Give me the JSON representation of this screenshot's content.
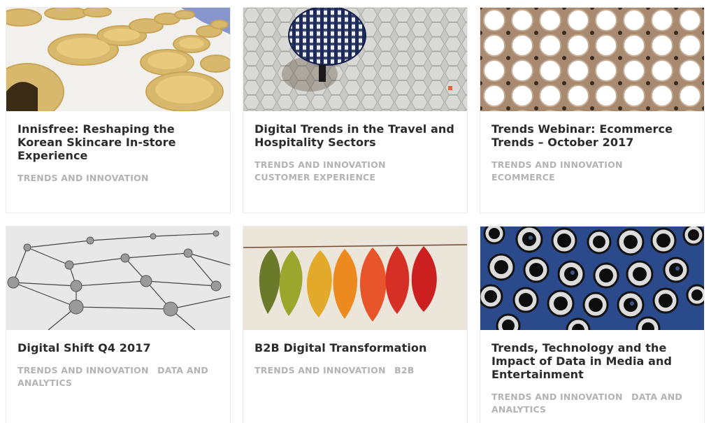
{
  "articles": [
    {
      "title": "Innisfree: Reshaping the Korean Skincare In-store Experience",
      "image": "concrete-planters-photo",
      "tags": [
        "TRENDS AND INNOVATION"
      ]
    },
    {
      "title": "Digital Trends in the Travel and Hospitality Sectors",
      "image": "umbrella-on-pavement-photo",
      "tags": [
        "TRENDS AND INNOVATION",
        "CUSTOMER EXPERIENCE"
      ]
    },
    {
      "title": "Trends Webinar: Ecommerce Trends – October 2017",
      "image": "circle-pattern-photo",
      "tags": [
        "TRENDS AND INNOVATION",
        "ECOMMERCE"
      ]
    },
    {
      "title": "Digital Shift Q4 2017",
      "image": "network-nodes-photo",
      "tags": [
        "TRENDS AND INNOVATION",
        "DATA AND ANALYTICS"
      ]
    },
    {
      "title": "B2B Digital Transformation",
      "image": "autumn-leaves-photo",
      "tags": [
        "TRENDS AND INNOVATION",
        "B2B"
      ]
    },
    {
      "title": "Trends, Technology and the Impact of Data in Media and Entertainment",
      "image": "camera-lenses-photo",
      "tags": [
        "TRENDS AND INNOVATION",
        "DATA AND ANALYTICS"
      ]
    }
  ],
  "colors": {
    "title": "#2b2b2b",
    "tag": "#b3b3b3",
    "border": "#ececec"
  }
}
